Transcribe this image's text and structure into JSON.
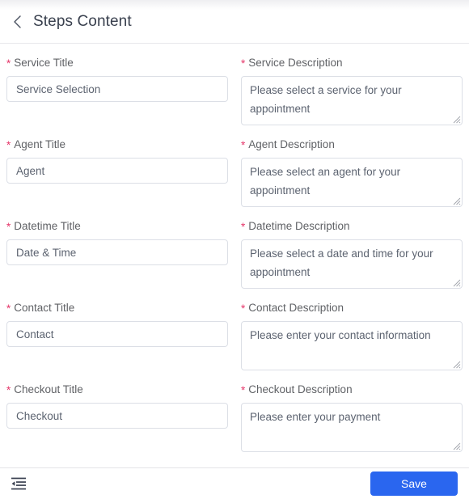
{
  "header": {
    "title": "Steps Content",
    "back_icon": "chevron-left-icon"
  },
  "form": {
    "rows": [
      {
        "left": {
          "label": "Service Title",
          "required": "*",
          "value": "Service Selection",
          "type": "input"
        },
        "right": {
          "label": "Service Description",
          "required": "*",
          "value": "Please select a service for your appointment",
          "type": "textarea"
        }
      },
      {
        "left": {
          "label": "Agent Title",
          "required": "*",
          "value": "Agent",
          "type": "input"
        },
        "right": {
          "label": "Agent Description",
          "required": "*",
          "value": "Please select an agent for your appointment",
          "type": "textarea"
        }
      },
      {
        "left": {
          "label": "Datetime Title",
          "required": "*",
          "value": "Date & Time",
          "type": "input"
        },
        "right": {
          "label": "Datetime Description",
          "required": "*",
          "value": "Please select a date and time for your appointment",
          "type": "textarea"
        }
      },
      {
        "left": {
          "label": "Contact Title",
          "required": "*",
          "value": "Contact",
          "type": "input"
        },
        "right": {
          "label": "Contact Description",
          "required": "*",
          "value": "Please enter your contact information",
          "type": "textarea"
        }
      },
      {
        "left": {
          "label": "Checkout Title",
          "required": "*",
          "value": "Checkout",
          "type": "input"
        },
        "right": {
          "label": "Checkout Description",
          "required": "*",
          "value": "Please enter your payment",
          "type": "textarea"
        }
      }
    ]
  },
  "footer": {
    "fold_icon": "menu-fold-icon",
    "save_label": "Save"
  },
  "colors": {
    "accent": "#2a66ef",
    "required_star": "#e5366a",
    "label_text": "#606266",
    "title_text": "#39404e",
    "border": "#dcdfe6"
  }
}
